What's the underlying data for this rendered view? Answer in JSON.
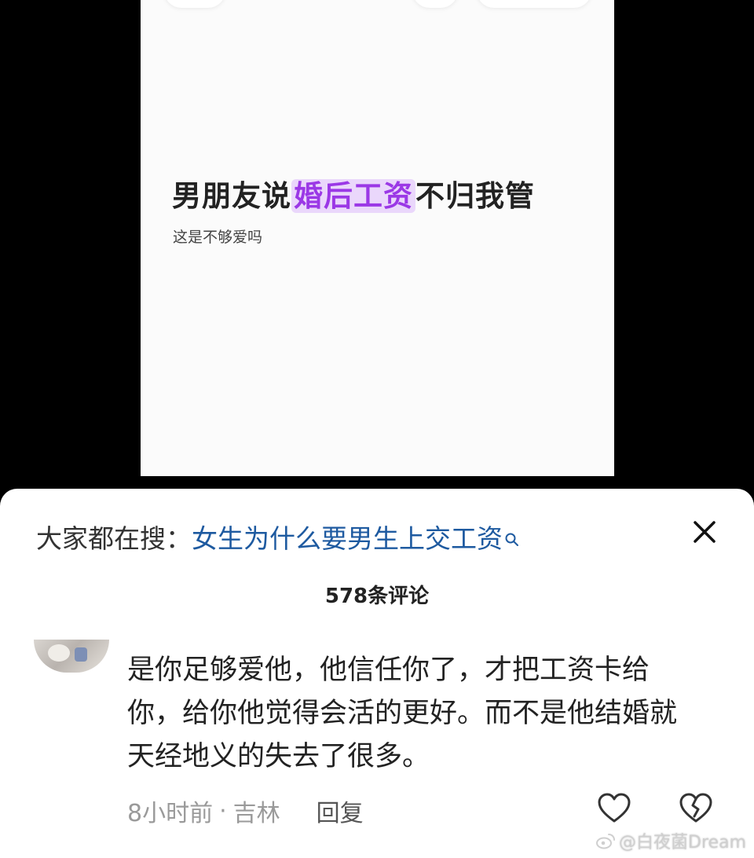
{
  "video_card": {
    "title_before": "男朋友说",
    "title_highlight": "婚后工资",
    "title_after": "不归我管",
    "subtitle": "这是不够爱吗"
  },
  "search_suggestion": {
    "prefix": "大家都在搜：",
    "query": "女生为什么要男生上交工资",
    "icon": "search-icon"
  },
  "close_icon": "close-icon",
  "comments": {
    "count_label": "578条评论",
    "items": [
      {
        "text": "是你足够爱他，他信任你了，才把工资卡给你，给你他觉得会活的更好。而不是他结婚就天经地义的失去了很多。",
        "time": "8小时前",
        "separator": "·",
        "location": "吉林",
        "reply_label": "回复",
        "like_icon": "heart-icon",
        "dislike_icon": "broken-heart-icon"
      }
    ]
  },
  "watermark": {
    "text": "@白夜菌Dream",
    "icon": "weibo-icon"
  },
  "colors": {
    "highlight_text": "#9b38e6",
    "highlight_bg": "#ead7fb",
    "search_link": "#1e5aa0",
    "meta_gray": "#9a9a9a"
  }
}
